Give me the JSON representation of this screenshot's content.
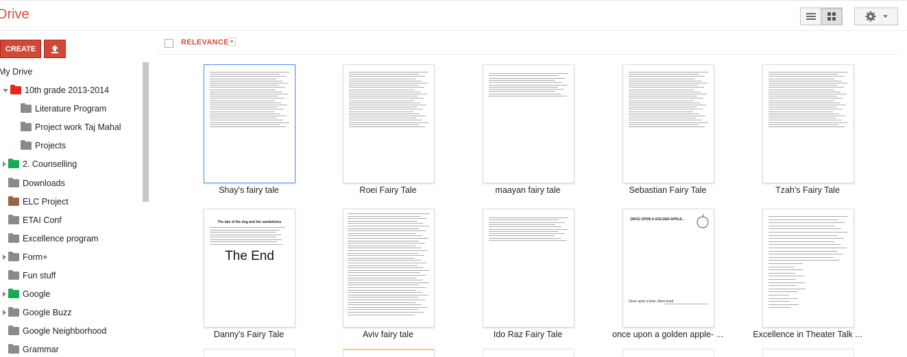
{
  "app": {
    "title": "Drive"
  },
  "toolbar": {
    "create_label": "CREATE",
    "sort_label": "RELEVANCE",
    "upload_icon": "upload-arrow-icon",
    "list_view_icon": "list-view-icon",
    "grid_view_icon": "grid-view-icon",
    "settings_icon": "gear-icon"
  },
  "sidebar": {
    "root_label": "My Drive",
    "items": [
      {
        "label": "10th grade 2013-2014",
        "color": "#e8281b",
        "expander": "open",
        "indent": 0
      },
      {
        "label": "Literature Program",
        "color": "#8a8a8a",
        "expander": "none",
        "indent": 1
      },
      {
        "label": "Project work Taj Mahal",
        "color": "#8a8a8a",
        "expander": "none",
        "indent": 1
      },
      {
        "label": "Projects",
        "color": "#8a8a8a",
        "expander": "none",
        "indent": 1
      },
      {
        "label": "2. Counselling",
        "color": "#1aaa55",
        "expander": "closed",
        "indent": 0
      },
      {
        "label": "Downloads",
        "color": "#8a8a8a",
        "expander": "none",
        "indent": 0
      },
      {
        "label": "ELC Project",
        "color": "#a0614b",
        "expander": "none",
        "indent": 0
      },
      {
        "label": "ETAI Conf",
        "color": "#8a8a8a",
        "expander": "none",
        "indent": 0
      },
      {
        "label": "Excellence program",
        "color": "#8a8a8a",
        "expander": "none",
        "indent": 0
      },
      {
        "label": "Form+",
        "color": "#8a8a8a",
        "expander": "closed",
        "indent": 0
      },
      {
        "label": "Fun stuff",
        "color": "#8a8a8a",
        "expander": "none",
        "indent": 0
      },
      {
        "label": "Google",
        "color": "#1aaa55",
        "expander": "closed",
        "indent": 0
      },
      {
        "label": "Google Buzz",
        "color": "#8a8a8a",
        "expander": "closed",
        "indent": 0
      },
      {
        "label": "Google Neighborhood",
        "color": "#8a8a8a",
        "expander": "none",
        "indent": 0
      },
      {
        "label": "Grammar",
        "color": "#8a8a8a",
        "expander": "none",
        "indent": 0
      }
    ]
  },
  "files": [
    {
      "title": "Shay's fairy tale",
      "selected": true,
      "variant": "text"
    },
    {
      "title": "Roei Fairy Tale",
      "selected": false,
      "variant": "text"
    },
    {
      "title": "maayan fairy tale",
      "selected": false,
      "variant": "text-short"
    },
    {
      "title": "Sebastian Fairy Tale",
      "selected": false,
      "variant": "text"
    },
    {
      "title": "Tzah's Fairy Tale",
      "selected": false,
      "variant": "text"
    },
    {
      "title": "Danny's Fairy Tale",
      "selected": false,
      "variant": "the-end",
      "heading": "The tale of the dog and the sandwiches",
      "big_text": "The End"
    },
    {
      "title": "Aviv fairy tale",
      "selected": false,
      "variant": "text-dense"
    },
    {
      "title": "Ido Raz Fairy Tale",
      "selected": false,
      "variant": "text-short"
    },
    {
      "title": "once upon a golden apple- ...",
      "selected": false,
      "variant": "storyboard",
      "heading": "ONCE UPON A GOLDEN APPLE...",
      "caption": "Once upon a time, there lived"
    },
    {
      "title": "Excellence in Theater Talk ...",
      "selected": false,
      "variant": "text-list"
    }
  ]
}
